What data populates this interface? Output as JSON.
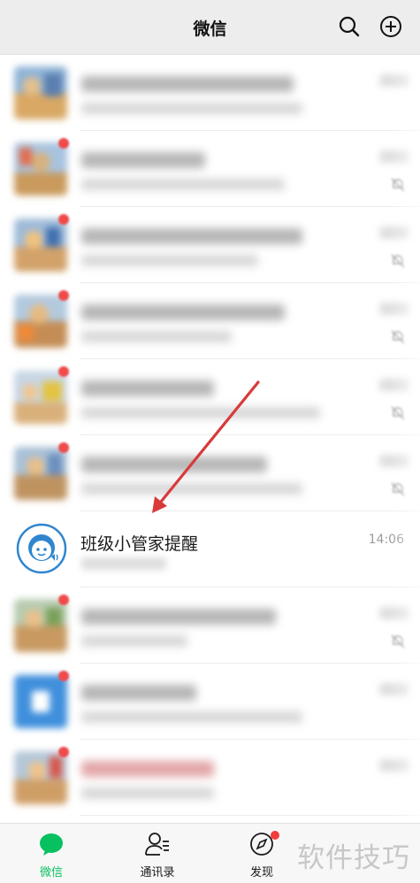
{
  "header": {
    "title": "微信"
  },
  "highlighted_chat": {
    "name": "班级小管家提醒",
    "time": "14:06"
  },
  "tabs": [
    {
      "label": "微信",
      "active": true
    },
    {
      "label": "通讯录",
      "active": false
    },
    {
      "label": "发现",
      "active": false,
      "badge": true
    }
  ],
  "watermark": "软件技巧",
  "colors": {
    "header_bg": "#ededed",
    "accent_green": "#07c160",
    "badge_red": "#f23c3c",
    "arrow_red": "#d93a3a",
    "avatar_blue": "#2f86cf"
  }
}
